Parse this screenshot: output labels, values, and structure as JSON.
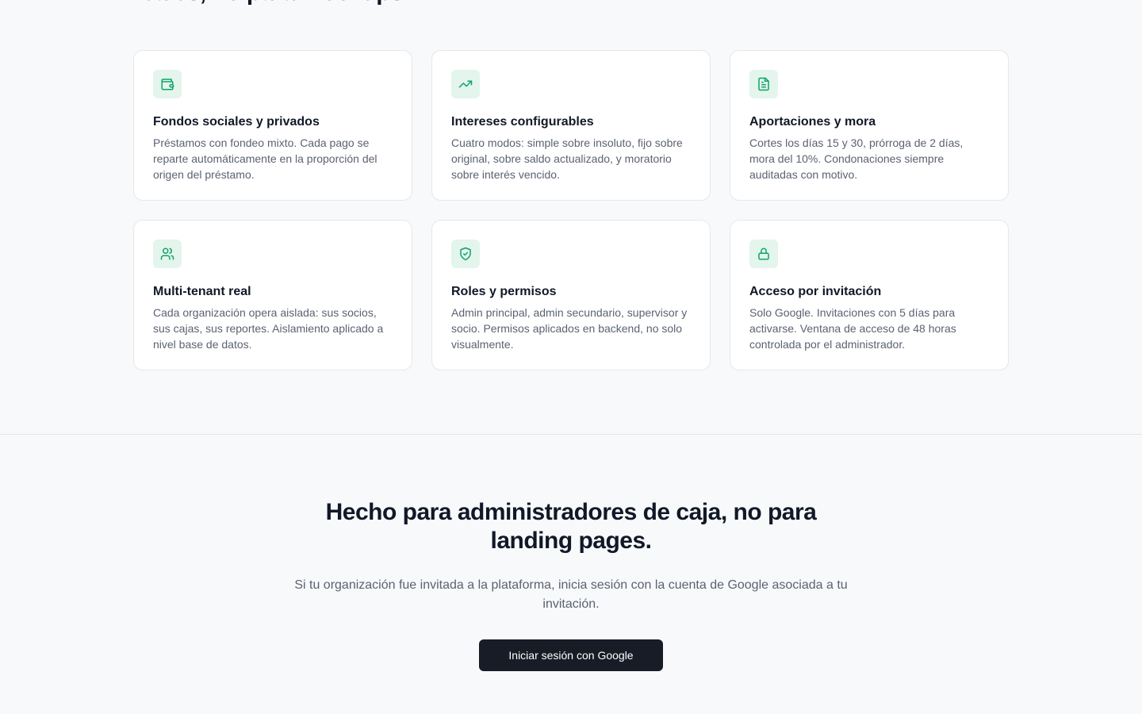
{
  "features_section": {
    "title_cut": "reales, no para mockups."
  },
  "features": [
    {
      "icon": "wallet-icon",
      "title": "Fondos sociales y privados",
      "desc": "Préstamos con fondeo mixto. Cada pago se reparte automáticamente en la proporción del origen del préstamo."
    },
    {
      "icon": "trending-up-icon",
      "title": "Intereses configurables",
      "desc": "Cuatro modos: simple sobre insoluto, fijo sobre original, sobre saldo actualizado, y moratorio sobre interés vencido."
    },
    {
      "icon": "document-icon",
      "title": "Aportaciones y mora",
      "desc": "Cortes los días 15 y 30, prórroga de 2 días, mora del 10%. Condonaciones siempre auditadas con motivo."
    },
    {
      "icon": "users-icon",
      "title": "Multi-tenant real",
      "desc": "Cada organización opera aislada: sus socios, sus cajas, sus reportes. Aislamiento aplicado a nivel base de datos."
    },
    {
      "icon": "shield-check-icon",
      "title": "Roles y permisos",
      "desc": "Admin principal, admin secundario, supervisor y socio. Permisos aplicados en backend, no solo visualmente."
    },
    {
      "icon": "lock-icon",
      "title": "Acceso por invitación",
      "desc": "Solo Google. Invitaciones con 5 días para activarse. Ventana de acceso de 48 horas controlada por el administrador."
    }
  ],
  "cta": {
    "title": "Hecho para administradores de caja, no para landing pages.",
    "subtitle": "Si tu organización fue invitada a la plataforma, inicia sesión con la cuenta de Google asociada a tu invitación.",
    "button_label": "Iniciar sesión con Google"
  },
  "colors": {
    "accent": "#10a36b",
    "icon_bg": "#e3f5ec",
    "button_bg": "#171c26",
    "page_bg": "#f8f9fb"
  }
}
